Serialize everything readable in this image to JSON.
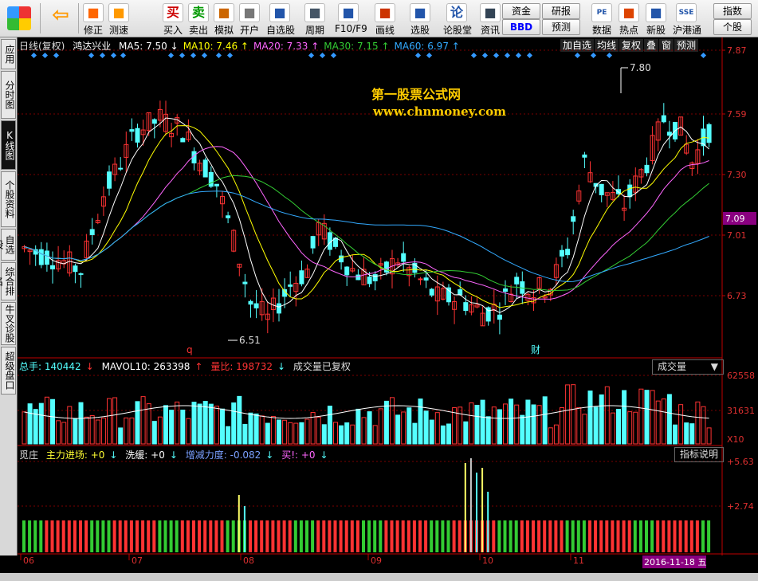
{
  "toolbar": {
    "buttons": [
      {
        "label": "修正",
        "icon": "up-arrow-icon"
      },
      {
        "label": "测速",
        "icon": "refresh-icon"
      },
      {
        "label": "买入",
        "icon": "buy-icon",
        "glyph": "买"
      },
      {
        "label": "卖出",
        "icon": "sell-icon",
        "glyph": "卖"
      },
      {
        "label": "模拟",
        "icon": "hammer-icon"
      },
      {
        "label": "开户",
        "icon": "lock-icon"
      },
      {
        "label": "自选股",
        "icon": "star-icon"
      },
      {
        "label": "周期",
        "icon": "clock-icon"
      },
      {
        "label": "F10/F9",
        "icon": "f10-icon"
      },
      {
        "label": "画线",
        "icon": "pen-icon"
      },
      {
        "label": "选股",
        "icon": "monitor-icon"
      },
      {
        "label": "论股堂",
        "icon": "discuss-icon",
        "glyph": "论"
      },
      {
        "label": "资讯",
        "icon": "info-icon"
      },
      {
        "label": "数据",
        "icon": "pe-icon",
        "glyph": "PE"
      },
      {
        "label": "热点",
        "icon": "fire-icon"
      },
      {
        "label": "新股",
        "icon": "document-icon"
      },
      {
        "label": "沪港通",
        "icon": "sse-icon",
        "glyph": "SSE"
      }
    ],
    "small": {
      "fund": "资金",
      "research": "研报",
      "bbd": "BBD",
      "forecast": "预测",
      "index": "指数",
      "stock": "个股"
    }
  },
  "left_tabs": [
    "应用",
    "分时图",
    "K线图",
    "个股资料",
    "自选股",
    "综合排名",
    "牛叉诊股",
    "超级盘口"
  ],
  "kline": {
    "stock": "鸿达兴业",
    "period": "日线(复权)",
    "ma": [
      {
        "label": "MA5: 7.50",
        "dir": "↓",
        "color": "#ffffff"
      },
      {
        "label": "MA10: 7.46",
        "dir": "↑",
        "color": "#ffff00"
      },
      {
        "label": "MA20: 7.33",
        "dir": "↑",
        "color": "#ff66ff"
      },
      {
        "label": "MA30: 7.15",
        "dir": "↑",
        "color": "#33cc33"
      },
      {
        "label": "MA60: 6.97",
        "dir": "↑",
        "color": "#33aaff"
      }
    ],
    "buttons": [
      "加自选",
      "均线",
      "复权",
      "叠",
      "窗",
      "预测"
    ],
    "y_ticks": [
      "7.87",
      "7.59",
      "7.30",
      "7.01",
      "6.73"
    ],
    "current_price": "7.09",
    "high_label": "7.80",
    "low_label": "6.51",
    "watermark_title": "第一股票公式网",
    "watermark_url": "www.chnmoney.com",
    "markers": {
      "q": "q",
      "cai": "财"
    }
  },
  "volume": {
    "total": "总手: 140442",
    "mavol": "MAVOL10: 263398",
    "ratio": "量比: 198732",
    "note": "成交量已复权",
    "selector": "成交量",
    "y_ticks": [
      "62558",
      "31631"
    ],
    "unit": "X10"
  },
  "indicator": {
    "name": "觅庄",
    "main_in": "主力进场: +0",
    "wash": "洗缓: +0",
    "force": "增减力度: -0.082",
    "buy": "买!: +0",
    "help": "指标说明",
    "y_ticks": [
      "+5.63",
      "+2.74"
    ]
  },
  "xaxis": {
    "months": [
      "06",
      "07",
      "08",
      "09",
      "10",
      "11"
    ],
    "date": "2016-11-18",
    "weekday": "五"
  },
  "colors": {
    "up": "#ff3333",
    "down": "#54ffff",
    "grid": "#7a0000",
    "axis": "#c00000"
  }
}
